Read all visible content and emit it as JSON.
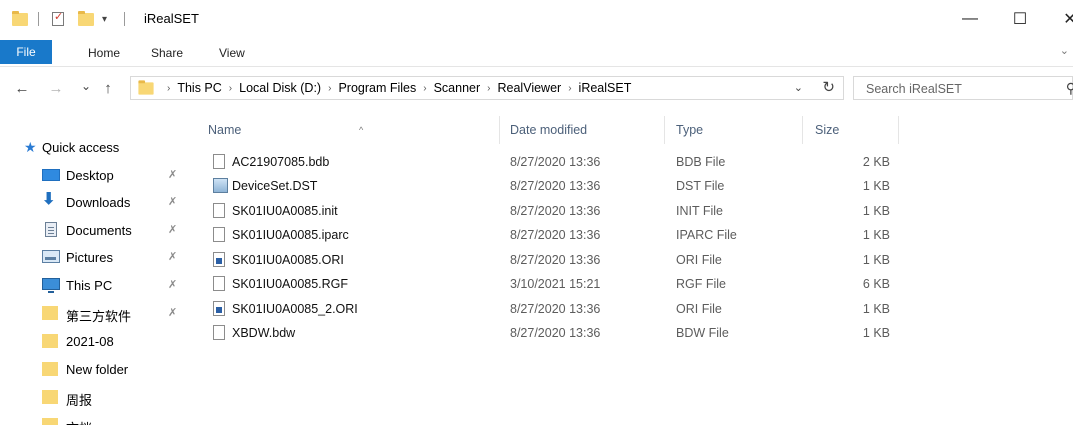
{
  "window": {
    "title": "iRealSET",
    "minimize_glyph": "—",
    "maximize_glyph": "☐",
    "close_glyph": "✕"
  },
  "ribbon": {
    "tabs": [
      "File",
      "Home",
      "Share",
      "View"
    ],
    "file_tab_color": "#1979ca"
  },
  "nav": {
    "back_glyph": "←",
    "forward_glyph": "→",
    "recent_glyph": "⌄",
    "up_glyph": "↑",
    "breadcrumbs": [
      "This PC",
      "Local Disk (D:)",
      "Program Files",
      "Scanner",
      "RealViewer",
      "iRealSET"
    ],
    "dropdown_glyph": "⌄",
    "refresh_glyph": "↻"
  },
  "search": {
    "placeholder": "Search iRealSET"
  },
  "navpane": {
    "quick_access": "Quick access",
    "items": [
      {
        "label": "Desktop",
        "icon": "desktop-icon",
        "pinned": true
      },
      {
        "label": "Downloads",
        "icon": "downloads-icon",
        "pinned": true
      },
      {
        "label": "Documents",
        "icon": "documents-icon",
        "pinned": true
      },
      {
        "label": "Pictures",
        "icon": "pictures-icon",
        "pinned": true
      },
      {
        "label": "This PC",
        "icon": "this-pc-icon",
        "pinned": true
      },
      {
        "label": "第三方软件",
        "icon": "folder-icon",
        "pinned": true
      },
      {
        "label": "2021-08",
        "icon": "folder-icon",
        "pinned": false
      },
      {
        "label": "New folder",
        "icon": "folder-icon",
        "pinned": false
      },
      {
        "label": "周报",
        "icon": "folder-icon",
        "pinned": false
      },
      {
        "label": "文档",
        "icon": "folder-icon",
        "pinned": false
      }
    ]
  },
  "columns": {
    "name": "Name",
    "date": "Date modified",
    "type": "Type",
    "size": "Size"
  },
  "files": [
    {
      "name": "AC21907085.bdb",
      "date": "8/27/2020 13:36",
      "type": "BDB File",
      "size": "2 KB",
      "icon": "blank-file-icon"
    },
    {
      "name": "DeviceSet.DST",
      "date": "8/27/2020 13:36",
      "type": "DST File",
      "size": "1 KB",
      "icon": "dst-file-icon"
    },
    {
      "name": "SK01IU0A0085.init",
      "date": "8/27/2020 13:36",
      "type": "INIT File",
      "size": "1 KB",
      "icon": "blank-file-icon"
    },
    {
      "name": "SK01IU0A0085.iparc",
      "date": "8/27/2020 13:36",
      "type": "IPARC File",
      "size": "1 KB",
      "icon": "blank-file-icon"
    },
    {
      "name": "SK01IU0A0085.ORI",
      "date": "8/27/2020 13:36",
      "type": "ORI File",
      "size": "1 KB",
      "icon": "ori-file-icon"
    },
    {
      "name": "SK01IU0A0085.RGF",
      "date": "3/10/2021 15:21",
      "type": "RGF File",
      "size": "6 KB",
      "icon": "blank-file-icon"
    },
    {
      "name": "SK01IU0A0085_2.ORI",
      "date": "8/27/2020 13:36",
      "type": "ORI File",
      "size": "1 KB",
      "icon": "ori-file-icon"
    },
    {
      "name": "XBDW.bdw",
      "date": "8/27/2020 13:36",
      "type": "BDW File",
      "size": "1 KB",
      "icon": "blank-file-icon"
    }
  ]
}
